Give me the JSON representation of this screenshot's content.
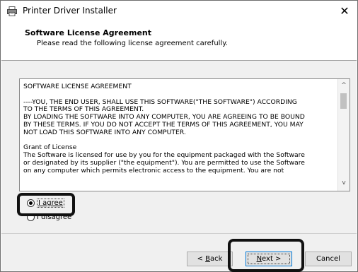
{
  "window": {
    "title": "Printer Driver Installer",
    "close_glyph": "✕",
    "icon": "printer-app-icon"
  },
  "header": {
    "title": "Software License Agreement",
    "subtitle": "Please read the following license agreement carefully."
  },
  "license": {
    "text": "SOFTWARE LICENSE AGREEMENT\n\n----YOU, THE END USER, SHALL USE THIS SOFTWARE(\"THE SOFTWARE\") ACCORDING\nTO THE TERMS OF THIS AGREEMENT.\nBY LOADING THE SOFTWARE INTO ANY COMPUTER, YOU ARE AGREEING TO BE BOUND\nBY THESE TERMS. IF YOU DO NOT ACCEPT THE TERMS OF THIS AGREEMENT, YOU MAY\nNOT LOAD THIS SOFTWARE INTO ANY COMPUTER.\n\nGrant of License\nThe Software is licensed for use by you for the equipment packaged with the Software\nor designated by its supplier (\"the equipment\"). You are permitted to use the Software\non any computer which permits electronic access to the equipment. You are not",
    "scroll_up_glyph": "^",
    "scroll_down_glyph": "v"
  },
  "options": {
    "agree_label": "I agree",
    "disagree_label": "I disagree",
    "selected": "agree"
  },
  "buttons": {
    "back_prefix": "< ",
    "back_accel": "B",
    "back_rest": "ack",
    "next_accel": "N",
    "next_rest": "ext >",
    "cancel_label": "Cancel"
  }
}
